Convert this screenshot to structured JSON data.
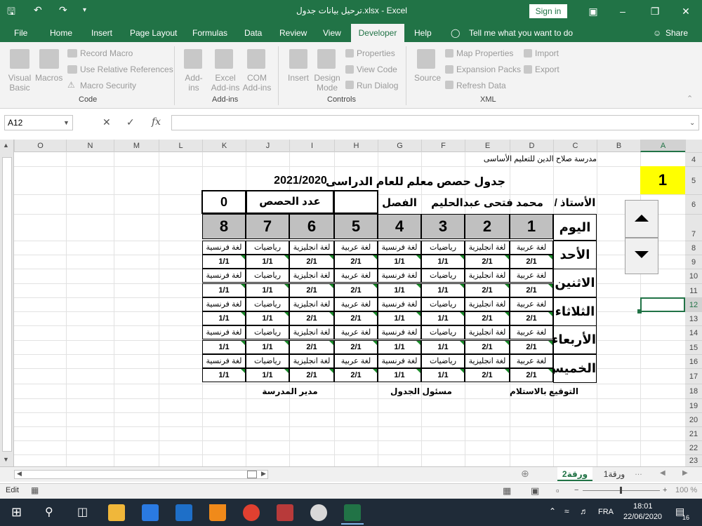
{
  "window": {
    "title": "ترحيل بيانات جدول.xlsx  -  Excel",
    "signin": "Sign in"
  },
  "menu": {
    "items": [
      "File",
      "Home",
      "Insert",
      "Page Layout",
      "Formulas",
      "Data",
      "Review",
      "View",
      "Developer",
      "Help"
    ],
    "tell_me": "Tell me what you want to do",
    "share": "Share"
  },
  "ribbon": {
    "code": {
      "visual_basic": "Visual Basic",
      "macros": "Macros",
      "record_macro": "Record Macro",
      "relative_refs": "Use Relative References",
      "macro_security": "Macro Security",
      "group": "Code"
    },
    "addins": {
      "addins": "Add-ins",
      "excel_addins": "Excel Add-ins",
      "com_addins": "COM Add-ins",
      "group": "Add-ins"
    },
    "controls": {
      "insert": "Insert",
      "design_mode": "Design Mode",
      "properties": "Properties",
      "view_code": "View Code",
      "run_dialog": "Run Dialog",
      "group": "Controls"
    },
    "xml": {
      "source": "Source",
      "map_properties": "Map Properties",
      "expansion_packs": "Expansion Packs",
      "refresh_data": "Refresh Data",
      "import": "Import",
      "export": "Export",
      "group": "XML"
    }
  },
  "formula_bar": {
    "name_box": "A12",
    "fx": "fx",
    "value": ""
  },
  "columns": [
    "O",
    "N",
    "M",
    "L",
    "K",
    "J",
    "I",
    "H",
    "G",
    "F",
    "E",
    "D",
    "C",
    "B",
    "A"
  ],
  "rows": [
    "4",
    "5",
    "6",
    "7",
    "8",
    "9",
    "10",
    "11",
    "12",
    "13",
    "14",
    "15",
    "16",
    "17",
    "18",
    "19",
    "20",
    "21",
    "22",
    "23"
  ],
  "sheet": {
    "school": "مدرسة صلاح الدين للتعليم الأساسى",
    "counter": "1",
    "title": "جدول حصص معلم للعام الدراسى",
    "year": "2021/2020",
    "teacher_label": "الأستاذ /",
    "teacher_name": "محمد فتحى عبدالحليم",
    "class_label": "الفصل",
    "class_value": "",
    "sessions_label": "عدد الحصص",
    "sessions_value": "0",
    "day_label": "اليوم",
    "periods": [
      "1",
      "2",
      "3",
      "4",
      "5",
      "6",
      "7",
      "8"
    ],
    "days": [
      "الأحد",
      "الاثنين",
      "الثلاثاء",
      "الأربعاء",
      "الخميس"
    ],
    "subjects": [
      "لغة عربية",
      "لغة انجليزية",
      "رياضيات",
      "لغة فرنسية",
      "لغة عربية",
      "لغة انجليزية",
      "رياضيات",
      "لغة فرنسية"
    ],
    "fractions": [
      "2/1",
      "2/1",
      "1/1",
      "1/1",
      "2/1",
      "2/1",
      "1/1",
      "1/1"
    ],
    "sign_receive": "التوقيع بالاستلام",
    "schedule_officer": "مسئول الجدول",
    "school_principal": "مدير المدرسة"
  },
  "tabs": {
    "sheet2": "ورقة2",
    "sheet1": "ورقة1"
  },
  "status": {
    "mode": "Edit",
    "zoom": "100 %"
  },
  "taskbar": {
    "lang": "FRA",
    "time": "18:01",
    "date": "22/06/2020",
    "notif": "16"
  }
}
